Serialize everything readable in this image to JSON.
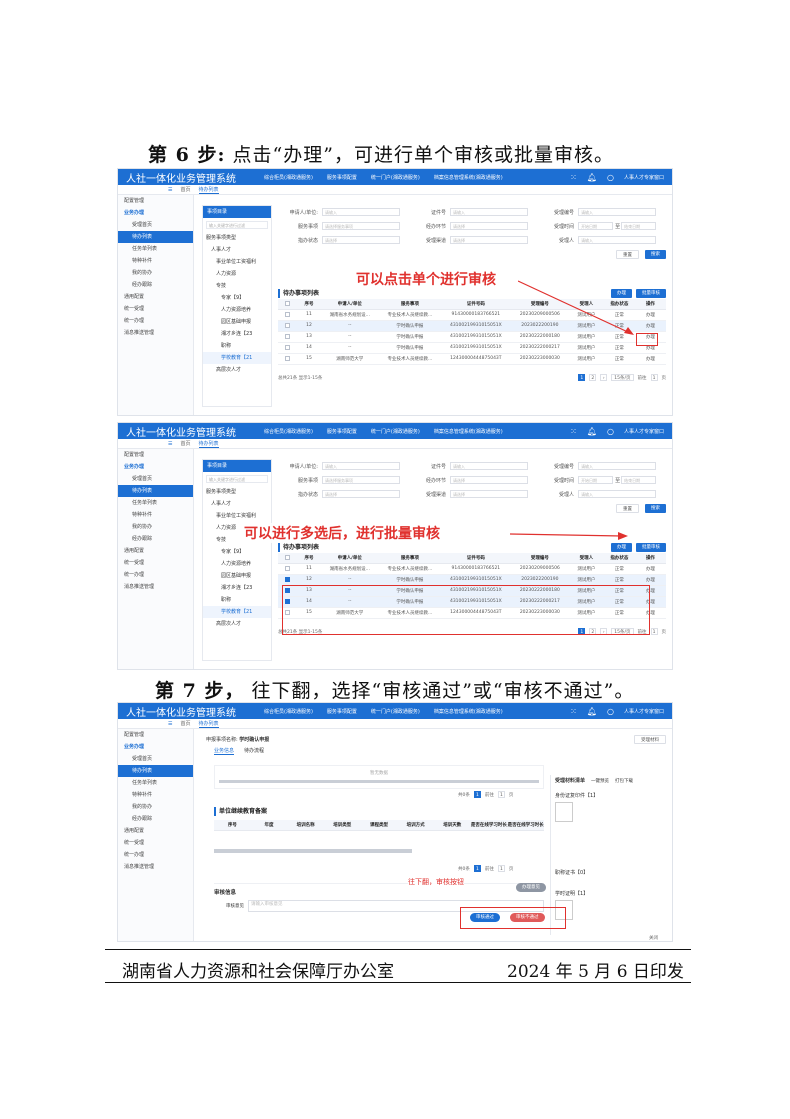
{
  "step6": {
    "label": "第 6 步:",
    "text": "点击“办理”，可进行单个审核或批量审核。"
  },
  "step7": {
    "label": "第 7 步，",
    "text": "往下翻，选择“审核通过”或“审核不通过”。"
  },
  "system_title": "人社一体化业务管理系统",
  "nav_links": [
    "综合柜员(湘政通服务)",
    "服务事项配置",
    "统一门户(湘政通服务)",
    "档案信息管理系统(湘政通服务)"
  ],
  "user_label": "人事人才专家窗口",
  "tabs": {
    "menu": "☰",
    "home": "首页",
    "current": "待办列表"
  },
  "sidebar": [
    {
      "label": "配置管理",
      "type": "item"
    },
    {
      "label": "业务办理",
      "type": "group"
    },
    {
      "label": "受理首页",
      "type": "sub"
    },
    {
      "label": "待办列表",
      "type": "active"
    },
    {
      "label": "任务单列表",
      "type": "sub"
    },
    {
      "label": "特种补件",
      "type": "sub"
    },
    {
      "label": "我的协办",
      "type": "sub"
    },
    {
      "label": "经办跟踪",
      "type": "sub"
    },
    {
      "label": "通用配置",
      "type": "item"
    },
    {
      "label": "统一受理",
      "type": "item"
    },
    {
      "label": "统一办理",
      "type": "item"
    },
    {
      "label": "消息推送管理",
      "type": "item"
    }
  ],
  "tree": {
    "title": "事项目录",
    "search_placeholder": "输入关键字进行过滤",
    "items": [
      "服务事项类型",
      "人事人才",
      "事业单位工资福利",
      "人力资源",
      "专技",
      "专家【9】",
      "人力资源培养",
      "园区基础申报",
      "湘才乡连【23",
      "职称",
      "学校教育【21",
      "高层次人才"
    ]
  },
  "form": {
    "applicant_label": "申请人/单位:",
    "applicant_ph": "请输入",
    "cert_label": "证件号",
    "cert_ph": "请输入",
    "accept_no_label": "受理编号",
    "accept_no_ph": "请输入",
    "service_label": "服务事项",
    "service_ph": "请选择服务事项",
    "stage_label": "经办环节",
    "stage_ph": "请选择",
    "accept_time_label": "受理时间",
    "time_start": "开始日期",
    "time_sep": "至",
    "time_end": "结束日期",
    "guide_label": "指办状态",
    "guide_ph": "请选择",
    "channel_label": "受理渠道",
    "channel_ph": "请选择",
    "handler_label": "受理人",
    "handler_ph": "请输入",
    "reset_btn": "重置",
    "search_btn": "搜索"
  },
  "list": {
    "title": "待办事项列表",
    "btn_handle": "办理",
    "btn_batch": "批量审核",
    "columns": [
      "",
      "序号",
      "申请人/单位",
      "服务事项",
      "证件号码",
      "受理编号",
      "受理人",
      "指办状态",
      "操作"
    ],
    "rows": [
      {
        "no": "11",
        "applicant": "湖南省水务规划设...",
        "service": "专业技术人员继续教...",
        "cert": "91430000183766521",
        "accept_no": "20230209000506",
        "handler": "测试用户",
        "status": "正常",
        "op": "办理"
      },
      {
        "no": "12",
        "applicant": "--",
        "service": "学时确认申报",
        "cert": "43100219931015051X",
        "accept_no": "2023022200190",
        "handler": "测试用户",
        "status": "正常",
        "op": "办理"
      },
      {
        "no": "13",
        "applicant": "--",
        "service": "学时确认申报",
        "cert": "43100219931015051X",
        "accept_no": "20230222000180",
        "handler": "测试用户",
        "status": "正常",
        "op": "办理"
      },
      {
        "no": "14",
        "applicant": "--",
        "service": "学时确认申报",
        "cert": "43100219931015051X",
        "accept_no": "20230222000217",
        "handler": "测试用户",
        "status": "正常",
        "op": "办理"
      },
      {
        "no": "15",
        "applicant": "湖南师范大学",
        "service": "专业技术人员继续教...",
        "cert": "12430000444875043T",
        "accept_no": "20230223000030",
        "handler": "测试用户",
        "status": "正常",
        "op": "办理"
      }
    ],
    "pager_total": "总共21条 显示1-15条",
    "pages": [
      "1",
      "2"
    ],
    "page_size": "15条/页",
    "goto": "前往",
    "goto_page": "1",
    "page_unit": "页"
  },
  "annotation1": "可以点击单个进行审核",
  "annotation2": "可以进行多选后，进行批量审核",
  "detail": {
    "apply_label": "申报事项名称:",
    "apply_name": "学时确认申报",
    "print_btn": "受理材料",
    "tab_business": "业务信息",
    "tab_process": "待办流程",
    "no_data": "暂无数据",
    "section_title": "单位继续教育备案",
    "columns": [
      "序号",
      "年度",
      "培训名称",
      "培训类型",
      "课程类型",
      "培训方式",
      "培训天数",
      "是否在线学习时长",
      "是否在线学习时长"
    ],
    "pager_total": "共0条",
    "goto": "前往",
    "page_unit": "页",
    "right_title": "受理材料清单",
    "right_tab1": "一键预览",
    "right_tab2": "打包下载",
    "mat1": "身份证复印件【1】",
    "mat2": "职称证书【0】",
    "mat3": "学时证明【1】",
    "review_title": "审核信息",
    "review_label": "审核意见",
    "review_ph": "请输入审核意见",
    "mini_btn": "办理意见",
    "approve_btn": "审核通过",
    "reject_btn": "审核不通过",
    "close_btn": "关闭"
  },
  "annotation3": "往下翻，审核按钮",
  "footer": {
    "left": "湖南省人力资源和社会保障厅办公室",
    "right": "2024 年 5 月 6 日印发"
  },
  "colors": {
    "brand": "#1d6fd3",
    "annotation": "#e0312e"
  }
}
